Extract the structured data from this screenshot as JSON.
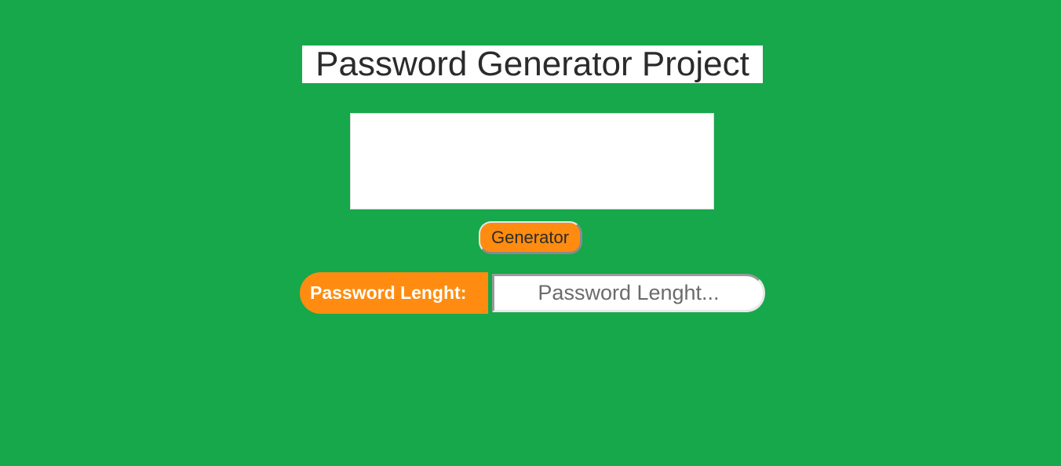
{
  "page": {
    "title": "Password Generator Project"
  },
  "output": {
    "value": ""
  },
  "generator": {
    "button_label": "Generator"
  },
  "length": {
    "label": "Password Lenght:",
    "value": "",
    "placeholder": "Password Lenght..."
  },
  "colors": {
    "background": "#16a84b",
    "accent": "#ff8c10",
    "text": "#2b2b2b"
  }
}
